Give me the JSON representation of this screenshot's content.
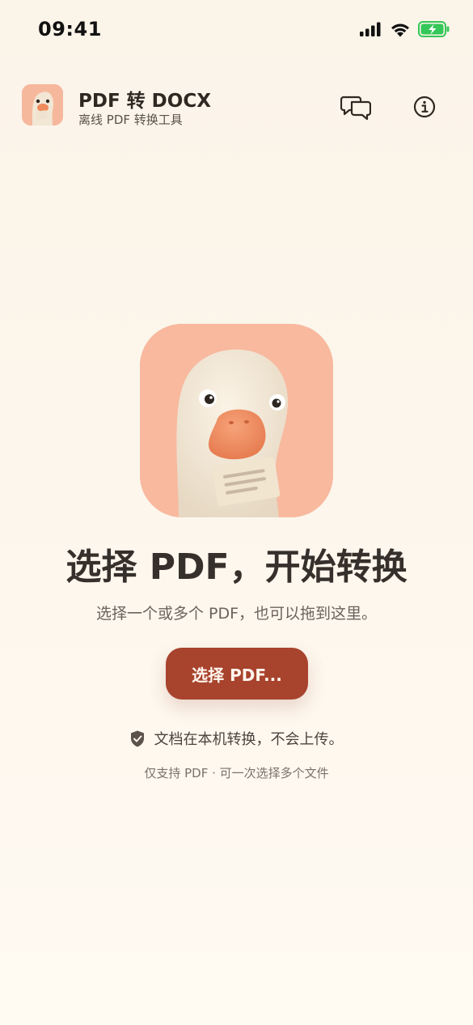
{
  "status_bar": {
    "time": "09:41",
    "icons": [
      "cellular-signal-icon",
      "wifi-icon",
      "battery-charging-icon"
    ],
    "battery_color": "#34c759"
  },
  "header": {
    "logo_icon": "goose-logo-icon",
    "title": "PDF 转 DOCX",
    "subtitle": "离线 PDF 转换工具",
    "actions": [
      {
        "icon": "chat-bubbles-icon"
      },
      {
        "icon": "info-icon"
      }
    ]
  },
  "hero": {
    "image_icon": "goose-holding-document-icon",
    "title": "选择 PDF，开始转换",
    "subtitle": "选择一个或多个 PDF，也可以拖到这里。"
  },
  "actions": {
    "select_button_label": "选择 PDF..."
  },
  "privacy": {
    "icon": "shield-check-icon",
    "text": "文档在本机转换，不会上传。"
  },
  "support_note": "仅支持 PDF · 可一次选择多个文件",
  "colors": {
    "background": "#fdf6ec",
    "accent": "#a8432d",
    "hero_tile": "#f8b99f",
    "goose_body": "#f3e9d8",
    "beak": "#f08a5d"
  }
}
